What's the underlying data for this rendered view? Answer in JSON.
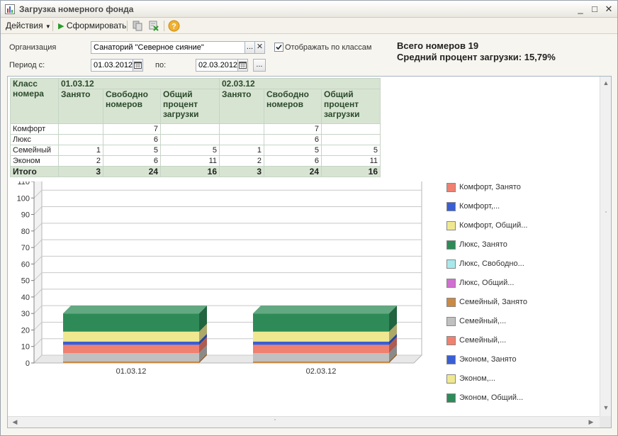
{
  "window": {
    "title": "Загрузка номерного фонда",
    "controls": [
      "_",
      "□",
      "✕"
    ]
  },
  "toolbar": {
    "actions_label": "Действия",
    "generate_label": "Сформировать"
  },
  "form": {
    "org_label": "Организация",
    "org_value": "Санаторий \"Северное сияние\"",
    "show_by_class_label": "Отображать по классам",
    "show_by_class_checked": true,
    "period_from_label": "Период с:",
    "period_from_value": "01.03.2012",
    "period_to_label": "по:",
    "period_to_value": "02.03.2012",
    "ellipsis": "...",
    "clear": "✕"
  },
  "summary": {
    "total_rooms": "Всего номеров 19",
    "avg_load": "Средний процент загрузки: 15,79%"
  },
  "table": {
    "class_header": "Класс номера",
    "dates": [
      "01.03.12",
      "02.03.12"
    ],
    "col_headers": [
      "Занято",
      "Свободно номеров",
      "Общий процент загрузки"
    ],
    "rows": [
      {
        "name": "Комфорт",
        "cells": [
          "",
          "7",
          "",
          "",
          "7",
          ""
        ]
      },
      {
        "name": "Люкс",
        "cells": [
          "",
          "6",
          "",
          "",
          "6",
          ""
        ]
      },
      {
        "name": "Семейный",
        "cells": [
          "1",
          "5",
          "5",
          "1",
          "5",
          "5"
        ]
      },
      {
        "name": "Эконом",
        "cells": [
          "2",
          "6",
          "11",
          "2",
          "6",
          "11"
        ]
      }
    ],
    "total": {
      "name": "Итого",
      "cells": [
        "3",
        "24",
        "16",
        "3",
        "24",
        "16"
      ]
    }
  },
  "chart_data": {
    "type": "bar",
    "stacked": true,
    "categories": [
      "01.03.12",
      "02.03.12"
    ],
    "ylim": [
      0,
      110
    ],
    "yticks": [
      "0",
      "10",
      "20",
      "30",
      "40",
      "50",
      "60",
      "70",
      "80",
      "90",
      "100",
      "110"
    ],
    "grid": true,
    "legend_position": "right",
    "series": [
      {
        "name": "Комфорт, Занято",
        "color": "#f08070",
        "values": [
          0,
          0
        ]
      },
      {
        "name": "Комфорт,...",
        "color": "#3a5fd4",
        "values": [
          0,
          0
        ]
      },
      {
        "name": "Комфорт, Общий...",
        "color": "#f0e890",
        "values": [
          0,
          0
        ]
      },
      {
        "name": "Люкс, Занято",
        "color": "#2e8b57",
        "values": [
          0,
          0
        ]
      },
      {
        "name": "Люкс, Свободно...",
        "color": "#a8e8ec",
        "values": [
          0,
          0
        ]
      },
      {
        "name": "Люкс, Общий...",
        "color": "#d070d0",
        "values": [
          0,
          0
        ]
      },
      {
        "name": "Семейный, Занято",
        "color": "#c98a45",
        "values": [
          1,
          1
        ]
      },
      {
        "name": "Семейный,...",
        "color": "#c0c0c0",
        "values": [
          5,
          5
        ]
      },
      {
        "name": "Семейный,...",
        "color": "#f08070",
        "values": [
          5,
          5
        ]
      },
      {
        "name": "Эконом, Занято",
        "color": "#3a5fd4",
        "values": [
          2,
          2
        ]
      },
      {
        "name": "Эконом,...",
        "color": "#f0e890",
        "values": [
          6,
          6
        ]
      },
      {
        "name": "Эконом, Общий...",
        "color": "#2e8b57",
        "values": [
          11,
          11
        ]
      }
    ]
  }
}
